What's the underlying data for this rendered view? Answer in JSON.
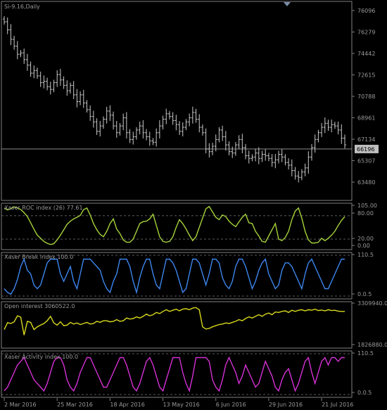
{
  "colors": {
    "background": "#000000",
    "frame": "#7f7f7f",
    "text": "#9a9a9a",
    "price_bars": "#c8c8c8",
    "price_line": "#8c8c8c",
    "price_label_bg": "#c0c0c0",
    "level_line": "#5a5a5a",
    "roc": "#a6d23a",
    "break": "#3d86ee",
    "oi": "#d8d81e",
    "activity": "#d431d4"
  },
  "chart_data": [
    {
      "type": "ohlc",
      "title": "Si-9.16,Daily",
      "x": [
        "2 Mar 2016",
        "25 Mar 2016",
        "18 Apr 2016",
        "13 May 2016",
        "6 Jun 2016",
        "29 Jun 2016",
        "21 Jul 2016"
      ],
      "y_ticks": [
        "76096",
        "76279",
        "74442",
        "72615",
        "70788",
        "68961",
        "67134",
        "65307",
        "63480"
      ],
      "ylim": [
        62500,
        77000
      ],
      "current_price": 66196,
      "current_price_label": "66196",
      "close": [
        75600,
        75000,
        74300,
        73800,
        73200,
        73300,
        72800,
        72400,
        71800,
        72000,
        71600,
        71100,
        71200,
        70800,
        70600,
        71100,
        71700,
        71300,
        70900,
        70500,
        70900,
        70200,
        69700,
        70200,
        69600,
        69100,
        68600,
        68200,
        67500,
        67900,
        68400,
        69000,
        68700,
        67900,
        67400,
        67900,
        68500,
        67400,
        66900,
        67100,
        67600,
        67900,
        67400,
        67100,
        66800,
        66700,
        67400,
        67900,
        68400,
        68800,
        68600,
        68300,
        68000,
        67500,
        67800,
        68200,
        68500,
        68900,
        68400,
        67800,
        67400,
        66200,
        66000,
        66400,
        66900,
        67600,
        67100,
        66500,
        66000,
        65900,
        66500,
        66900,
        66300,
        65700,
        65500,
        65600,
        65900,
        65500,
        65800,
        65700,
        65500,
        65200,
        65400,
        65800,
        65600,
        65200,
        65000,
        64600,
        64200,
        64100,
        64500,
        64800,
        65600,
        66300,
        66900,
        67400,
        67800,
        68100,
        67800,
        68000,
        67900,
        67600,
        67000,
        66500
      ]
    },
    {
      "type": "line",
      "name": "Xaser ROC index (26) 77.61",
      "series_name": "Xaser ROC index",
      "y_ticks": [
        "105.00",
        "80.00",
        "20.00",
        "0.00"
      ],
      "ylim": [
        0,
        105
      ],
      "levels": [
        80,
        20
      ],
      "values": [
        100,
        95,
        98,
        103,
        100,
        96,
        88,
        78,
        62,
        45,
        30,
        22,
        14,
        9,
        6,
        8,
        18,
        30,
        44,
        58,
        66,
        72,
        76,
        81,
        96,
        100,
        82,
        60,
        44,
        32,
        26,
        40,
        60,
        72,
        46,
        34,
        18,
        12,
        12,
        20,
        40,
        60,
        65,
        66,
        72,
        84,
        55,
        26,
        14,
        12,
        14,
        26,
        50,
        70,
        60,
        46,
        30,
        16,
        26,
        50,
        74,
        98,
        104,
        90,
        76,
        70,
        82,
        78,
        66,
        58,
        52,
        64,
        76,
        84,
        62,
        60,
        40,
        28,
        14,
        12,
        28,
        44,
        60,
        20,
        16,
        24,
        40,
        70,
        92,
        100,
        74,
        40,
        18,
        10,
        10,
        12,
        22,
        16,
        22,
        30,
        40,
        55,
        68,
        78
      ]
    },
    {
      "type": "line",
      "name": "Xaser Break index 100.0",
      "series_name": "Xaser Break index",
      "y_ticks": [
        "110.5",
        "0.0.5"
      ],
      "ylim": [
        0,
        110.5
      ],
      "values": [
        20,
        10,
        5,
        20,
        45,
        80,
        100,
        70,
        60,
        30,
        20,
        30,
        60,
        90,
        100,
        100,
        100,
        60,
        40,
        60,
        80,
        40,
        20,
        60,
        100,
        100,
        100,
        90,
        80,
        70,
        40,
        20,
        10,
        40,
        60,
        100,
        100,
        100,
        80,
        40,
        10,
        50,
        80,
        100,
        100,
        60,
        30,
        20,
        60,
        100,
        100,
        90,
        70,
        40,
        10,
        20,
        60,
        100,
        100,
        90,
        60,
        30,
        60,
        100,
        100,
        90,
        50,
        30,
        20,
        40,
        80,
        100,
        100,
        80,
        50,
        20,
        40,
        70,
        90,
        100,
        60,
        40,
        20,
        30,
        70,
        90,
        90,
        80,
        60,
        40,
        20,
        60,
        90,
        100,
        80,
        60,
        40,
        20,
        20,
        40,
        60,
        80,
        100,
        100
      ]
    },
    {
      "type": "line",
      "name": "Open interest 3060522.0",
      "series_name": "Open interest",
      "y_ticks": [
        "3309940.0",
        "1826880.0"
      ],
      "ylim": [
        1826880,
        3309940
      ],
      "values": [
        2400000,
        2650000,
        2620000,
        2680000,
        2900000,
        2850000,
        2200000,
        2700000,
        2660000,
        2400000,
        2500000,
        2560000,
        2620000,
        2720000,
        2880000,
        2640000,
        2560000,
        2680000,
        2540000,
        2560000,
        2660000,
        2600000,
        2640000,
        2580000,
        2620000,
        2660000,
        2600000,
        2620000,
        2700000,
        2660000,
        2720000,
        2720000,
        2680000,
        2700000,
        2760000,
        2700000,
        2720000,
        2820000,
        2780000,
        2800000,
        2860000,
        2820000,
        2880000,
        2960000,
        2900000,
        2940000,
        3020000,
        2980000,
        3060000,
        3120000,
        3060000,
        3100000,
        3140000,
        3080000,
        3140000,
        3160000,
        3120000,
        3180000,
        3200000,
        3120000,
        2500000,
        2420000,
        2440000,
        2500000,
        2540000,
        2580000,
        2600000,
        2640000,
        2620000,
        2660000,
        2700000,
        2760000,
        2720000,
        2800000,
        2860000,
        2820000,
        2880000,
        2940000,
        2880000,
        2960000,
        3000000,
        2940000,
        3040000,
        3020000,
        3060000,
        3080000,
        3020000,
        3100000,
        3060000,
        3100000,
        3120000,
        3080000,
        3120000,
        3100000,
        3140000,
        3090000,
        3110000,
        3080000,
        3120000,
        3090000,
        3100000,
        3070000,
        3060000,
        3060522
      ]
    },
    {
      "type": "line",
      "name": "Xaser Activity index 100.0",
      "series_name": "Xaser Activity index",
      "y_ticks": [
        "110.5",
        "0.0.5"
      ],
      "ylim": [
        0,
        110.5
      ],
      "values": [
        10,
        20,
        40,
        60,
        80,
        90,
        100,
        80,
        60,
        40,
        30,
        20,
        10,
        30,
        60,
        90,
        100,
        100,
        80,
        40,
        20,
        10,
        30,
        60,
        80,
        100,
        100,
        80,
        60,
        40,
        20,
        20,
        40,
        60,
        80,
        100,
        100,
        80,
        50,
        20,
        10,
        30,
        60,
        90,
        100,
        80,
        50,
        20,
        10,
        40,
        70,
        100,
        100,
        100,
        60,
        30,
        10,
        50,
        100,
        100,
        100,
        100,
        90,
        40,
        20,
        10,
        40,
        80,
        100,
        80,
        60,
        30,
        50,
        80,
        60,
        40,
        20,
        30,
        60,
        90,
        70,
        50,
        20,
        10,
        40,
        60,
        70,
        40,
        10,
        30,
        60,
        90,
        100,
        60,
        30,
        60,
        90,
        100,
        80,
        100,
        100,
        90,
        100,
        100
      ]
    }
  ]
}
